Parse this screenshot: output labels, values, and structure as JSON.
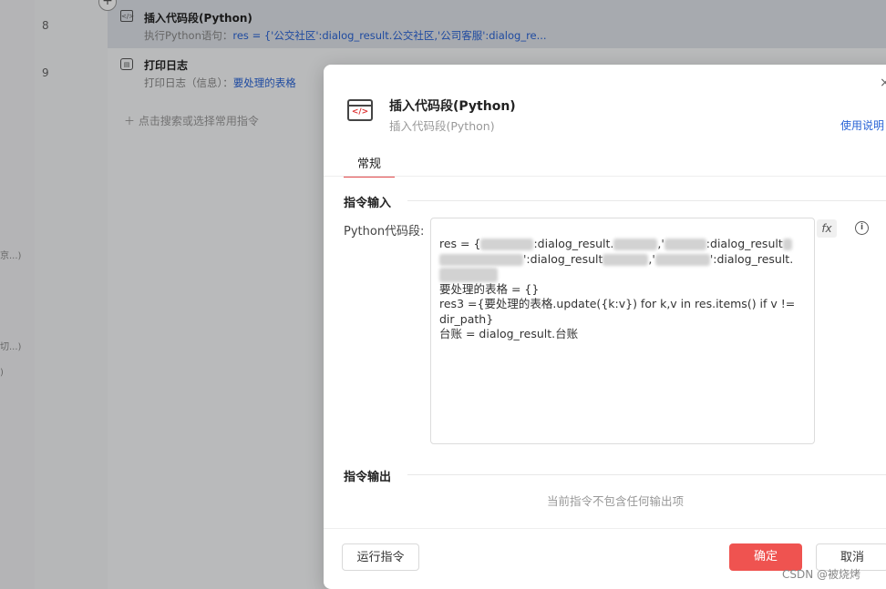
{
  "background": {
    "left_fragments": [
      "京...)",
      "切...)",
      ")"
    ],
    "rows": [
      {
        "num": "8",
        "title": "插入代码段(Python)",
        "sub_prefix": "执行Python语句：",
        "sub_value": "res = {'公交社区':dialog_result.公交社区,'公司客服':dialog_re..."
      },
      {
        "num": "9",
        "title": "打印日志",
        "sub_prefix": "打印日志（信息）：",
        "sub_value": "要处理的表格"
      }
    ],
    "add_hint": "点击搜索或选择常用指令"
  },
  "dialog": {
    "title": "插入代码段(Python)",
    "subtitle": "插入代码段(Python)",
    "help_link": "使用说明",
    "close": "×",
    "tab": "常规",
    "input_section": "指令输入",
    "field_label": "Python代码段:",
    "code_lines": {
      "l1_a": "res = {",
      "l1_b": ":dialog_result.",
      "l1_c": ",'",
      "l1_d": ":dialog_result",
      "l2_a": "':dialog_result",
      "l2_b": ",'",
      "l2_c": "':dialog_result.",
      "l4": "要处理的表格 = {}",
      "l5": "res3 ={要处理的表格.update({k:v}) for k,v in res.items() if v !=",
      "l6": "dir_path}",
      "l7": "台账 = dialog_result.台账"
    },
    "fx": "fx",
    "info": "i",
    "output_section": "指令输出",
    "no_output": "当前指令不包含任何输出项",
    "run_button": "运行指令",
    "ok_button": "确定",
    "cancel_button": "取消"
  },
  "watermark": "CSDN @被烧烤",
  "colors": {
    "accent": "#ef5350",
    "link": "#2a64d6"
  }
}
